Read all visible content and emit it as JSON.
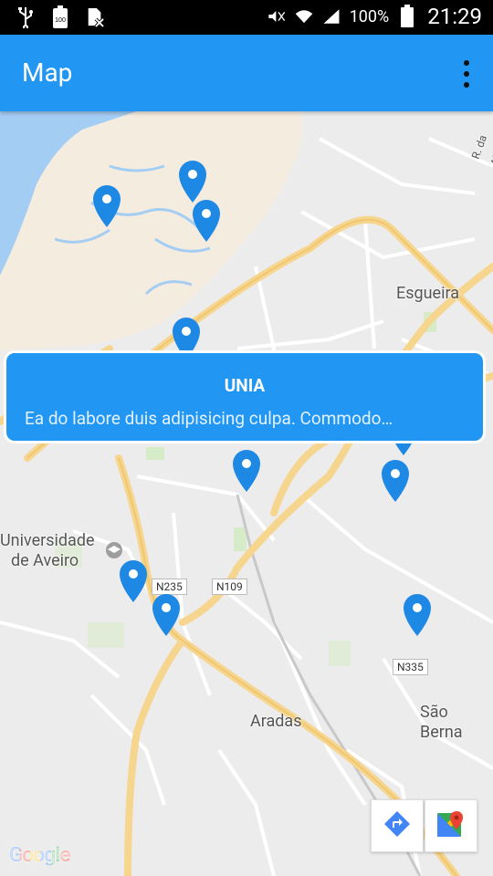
{
  "statusbar": {
    "battery_percent": "100%",
    "time": "21:29"
  },
  "appbar": {
    "title": "Map",
    "overflow_icon": "more-vert-icon"
  },
  "map": {
    "labels": {
      "esgueira": "Esgueira",
      "universidade_line1": "Universidade",
      "universidade_line2": "de Aveiro",
      "aradas": "Aradas",
      "sao_bernardo": "São Berna",
      "rua_alegria": "R. da Alegri"
    },
    "roads": {
      "n235": "N235",
      "n109": "N109",
      "n335": "N335"
    },
    "pin_color": "#1e88e5"
  },
  "info_card": {
    "title": "UNIA",
    "description": "Ea do labore duis adipisicing culpa. Commodo…"
  },
  "buttons": {
    "directions_icon": "directions-icon",
    "google_maps_icon": "google-maps-icon"
  },
  "attribution": {
    "google": "Google"
  }
}
